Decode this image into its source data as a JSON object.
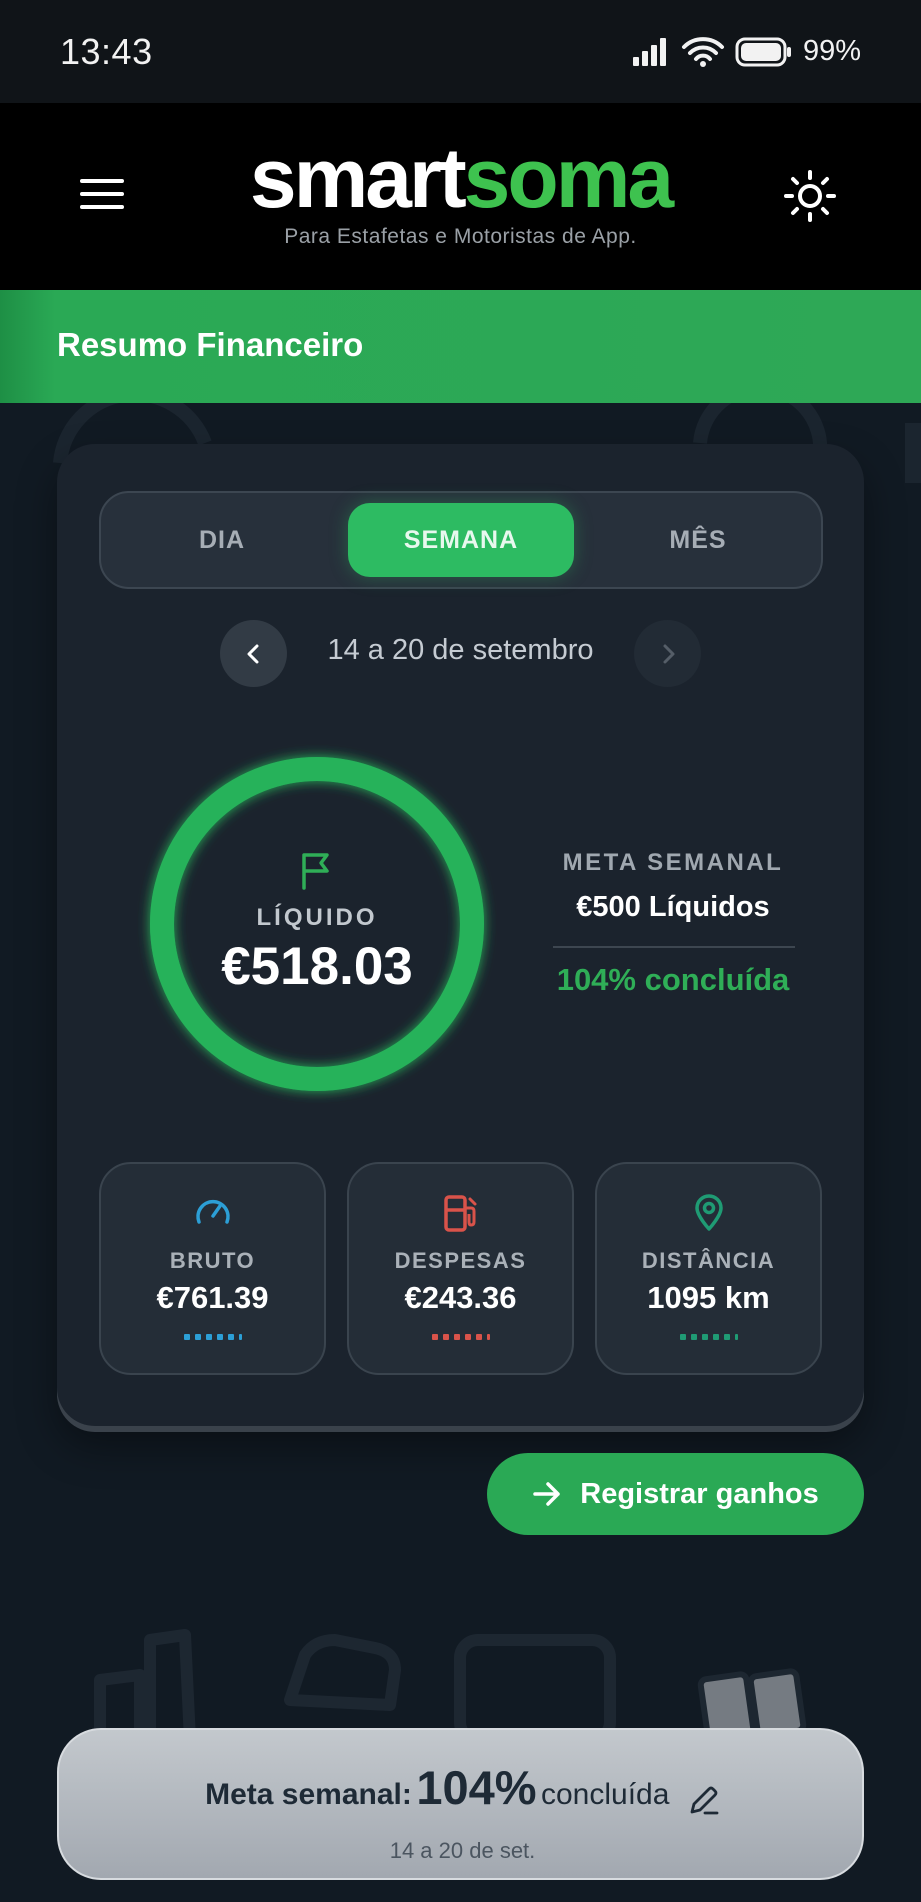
{
  "status_bar": {
    "time": "13:43",
    "battery": "99%",
    "icons": [
      "signal-icon",
      "wifi-icon",
      "battery-icon"
    ]
  },
  "header": {
    "logo_part1": "smart",
    "logo_part2": "soma",
    "tagline": "Para Estafetas e Motoristas de App.",
    "colors": {
      "brand_green": "#3ec24f"
    }
  },
  "section": {
    "title": "Resumo Financeiro"
  },
  "period_tabs": [
    {
      "label": "DIA",
      "active": false
    },
    {
      "label": "SEMANA",
      "active": true
    },
    {
      "label": "MÊS",
      "active": false
    }
  ],
  "date_range": "14 a 20 de setembro",
  "net": {
    "label": "LÍQUIDO",
    "value": "€518.03",
    "progress": 1.0
  },
  "goal": {
    "title": "META SEMANAL",
    "target": "€500 Líquidos",
    "percent_text": "104% concluída"
  },
  "stats": [
    {
      "label": "BRUTO",
      "value": "€761.39",
      "icon": "speedometer-icon",
      "color": "#2c9fd6"
    },
    {
      "label": "DESPESAS",
      "value": "€243.36",
      "icon": "fuel-pump-icon",
      "color": "#d9534a"
    },
    {
      "label": "DISTÂNCIA",
      "value": "1095 km",
      "icon": "map-pin-icon",
      "color": "#1f9b74"
    }
  ],
  "cta": {
    "label": "Registrar ganhos"
  },
  "bottom_summary": {
    "prefix": "Meta semanal:",
    "percent": "104%",
    "suffix": "concluída",
    "date": "14 a 20 de set."
  }
}
